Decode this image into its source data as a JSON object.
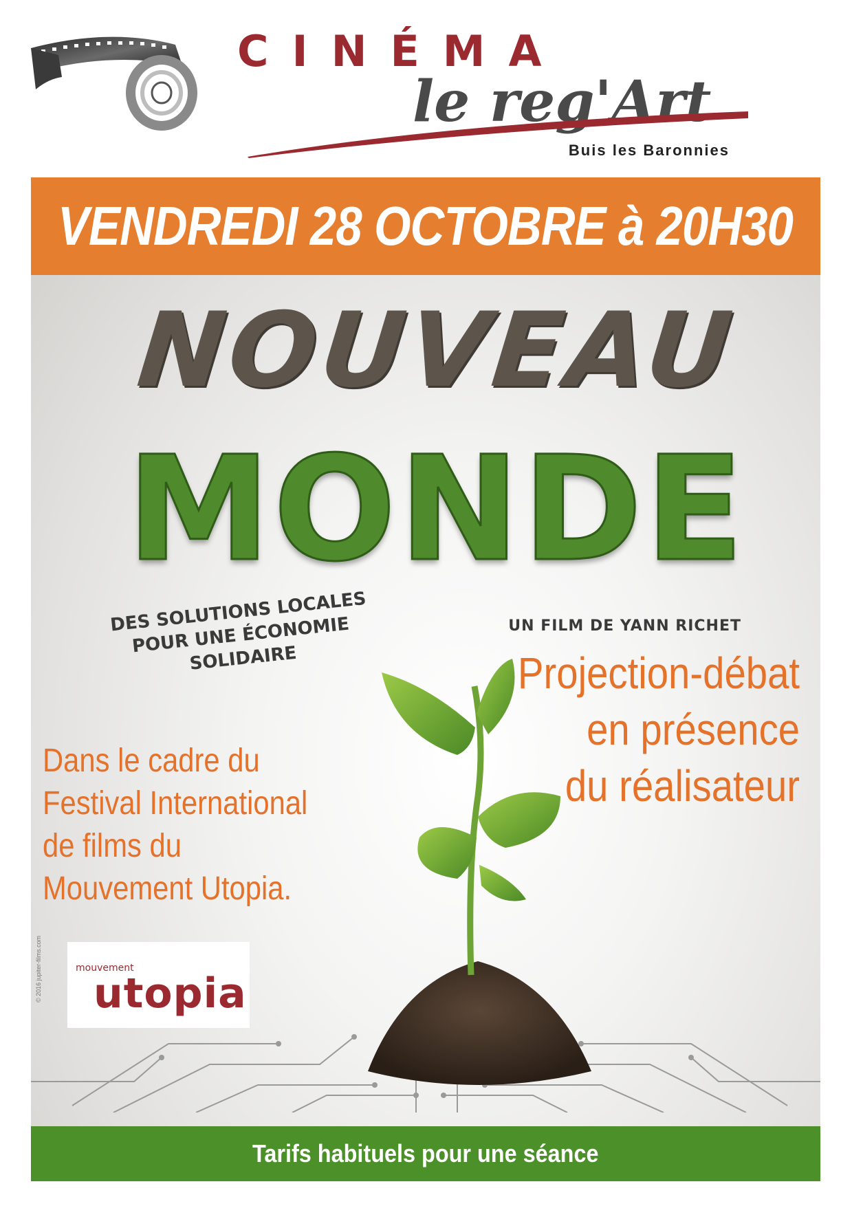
{
  "header": {
    "cinema": "CINÉMA",
    "name": "le reg'Art",
    "location": "Buis les Baronnies"
  },
  "banner": {
    "date": "VENDREDI 28 OCTOBRE à 20H30"
  },
  "film": {
    "title_line1": "NOUVEAU",
    "title_line2": "MONDE",
    "tagline_line1": "DES SOLUTIONS LOCALES",
    "tagline_line2": "POUR UNE ÉCONOMIE SOLIDAIRE",
    "director": "UN FILM DE YANN RICHET",
    "copyright": "© 2016 jupiter-films.com"
  },
  "event": {
    "debate_lines": [
      "Projection-débat",
      "en présence",
      "du réalisateur"
    ],
    "festival_lines": [
      "Dans le cadre du",
      "Festival International",
      "de films du",
      "Mouvement Utopia."
    ]
  },
  "logo": {
    "small": "mouvement",
    "big": "utopia"
  },
  "footer": {
    "price": "Tarifs habituels pour une séance"
  },
  "colors": {
    "brand_red": "#9b2a30",
    "orange": "#e57f2f",
    "green": "#4c9029",
    "text_orange": "#e5722a"
  }
}
